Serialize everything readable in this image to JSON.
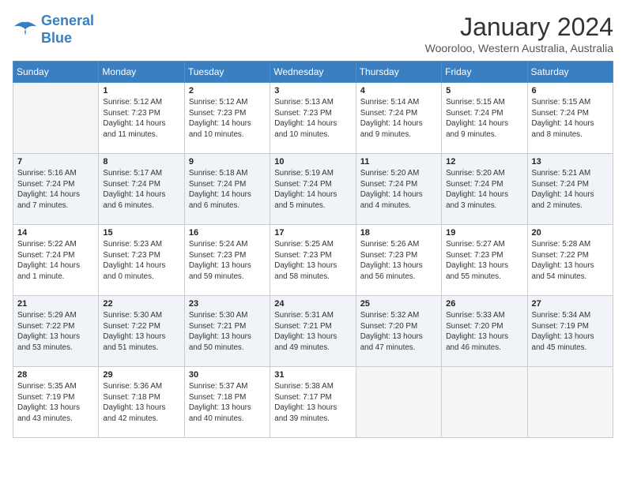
{
  "header": {
    "logo_line1": "General",
    "logo_line2": "Blue",
    "month": "January 2024",
    "location": "Wooroloo, Western Australia, Australia"
  },
  "weekdays": [
    "Sunday",
    "Monday",
    "Tuesday",
    "Wednesday",
    "Thursday",
    "Friday",
    "Saturday"
  ],
  "weeks": [
    [
      {
        "day": "",
        "info": ""
      },
      {
        "day": "1",
        "info": "Sunrise: 5:12 AM\nSunset: 7:23 PM\nDaylight: 14 hours\nand 11 minutes."
      },
      {
        "day": "2",
        "info": "Sunrise: 5:12 AM\nSunset: 7:23 PM\nDaylight: 14 hours\nand 10 minutes."
      },
      {
        "day": "3",
        "info": "Sunrise: 5:13 AM\nSunset: 7:23 PM\nDaylight: 14 hours\nand 10 minutes."
      },
      {
        "day": "4",
        "info": "Sunrise: 5:14 AM\nSunset: 7:24 PM\nDaylight: 14 hours\nand 9 minutes."
      },
      {
        "day": "5",
        "info": "Sunrise: 5:15 AM\nSunset: 7:24 PM\nDaylight: 14 hours\nand 9 minutes."
      },
      {
        "day": "6",
        "info": "Sunrise: 5:15 AM\nSunset: 7:24 PM\nDaylight: 14 hours\nand 8 minutes."
      }
    ],
    [
      {
        "day": "7",
        "info": "Sunrise: 5:16 AM\nSunset: 7:24 PM\nDaylight: 14 hours\nand 7 minutes."
      },
      {
        "day": "8",
        "info": "Sunrise: 5:17 AM\nSunset: 7:24 PM\nDaylight: 14 hours\nand 6 minutes."
      },
      {
        "day": "9",
        "info": "Sunrise: 5:18 AM\nSunset: 7:24 PM\nDaylight: 14 hours\nand 6 minutes."
      },
      {
        "day": "10",
        "info": "Sunrise: 5:19 AM\nSunset: 7:24 PM\nDaylight: 14 hours\nand 5 minutes."
      },
      {
        "day": "11",
        "info": "Sunrise: 5:20 AM\nSunset: 7:24 PM\nDaylight: 14 hours\nand 4 minutes."
      },
      {
        "day": "12",
        "info": "Sunrise: 5:20 AM\nSunset: 7:24 PM\nDaylight: 14 hours\nand 3 minutes."
      },
      {
        "day": "13",
        "info": "Sunrise: 5:21 AM\nSunset: 7:24 PM\nDaylight: 14 hours\nand 2 minutes."
      }
    ],
    [
      {
        "day": "14",
        "info": "Sunrise: 5:22 AM\nSunset: 7:24 PM\nDaylight: 14 hours\nand 1 minute."
      },
      {
        "day": "15",
        "info": "Sunrise: 5:23 AM\nSunset: 7:23 PM\nDaylight: 14 hours\nand 0 minutes."
      },
      {
        "day": "16",
        "info": "Sunrise: 5:24 AM\nSunset: 7:23 PM\nDaylight: 13 hours\nand 59 minutes."
      },
      {
        "day": "17",
        "info": "Sunrise: 5:25 AM\nSunset: 7:23 PM\nDaylight: 13 hours\nand 58 minutes."
      },
      {
        "day": "18",
        "info": "Sunrise: 5:26 AM\nSunset: 7:23 PM\nDaylight: 13 hours\nand 56 minutes."
      },
      {
        "day": "19",
        "info": "Sunrise: 5:27 AM\nSunset: 7:23 PM\nDaylight: 13 hours\nand 55 minutes."
      },
      {
        "day": "20",
        "info": "Sunrise: 5:28 AM\nSunset: 7:22 PM\nDaylight: 13 hours\nand 54 minutes."
      }
    ],
    [
      {
        "day": "21",
        "info": "Sunrise: 5:29 AM\nSunset: 7:22 PM\nDaylight: 13 hours\nand 53 minutes."
      },
      {
        "day": "22",
        "info": "Sunrise: 5:30 AM\nSunset: 7:22 PM\nDaylight: 13 hours\nand 51 minutes."
      },
      {
        "day": "23",
        "info": "Sunrise: 5:30 AM\nSunset: 7:21 PM\nDaylight: 13 hours\nand 50 minutes."
      },
      {
        "day": "24",
        "info": "Sunrise: 5:31 AM\nSunset: 7:21 PM\nDaylight: 13 hours\nand 49 minutes."
      },
      {
        "day": "25",
        "info": "Sunrise: 5:32 AM\nSunset: 7:20 PM\nDaylight: 13 hours\nand 47 minutes."
      },
      {
        "day": "26",
        "info": "Sunrise: 5:33 AM\nSunset: 7:20 PM\nDaylight: 13 hours\nand 46 minutes."
      },
      {
        "day": "27",
        "info": "Sunrise: 5:34 AM\nSunset: 7:19 PM\nDaylight: 13 hours\nand 45 minutes."
      }
    ],
    [
      {
        "day": "28",
        "info": "Sunrise: 5:35 AM\nSunset: 7:19 PM\nDaylight: 13 hours\nand 43 minutes."
      },
      {
        "day": "29",
        "info": "Sunrise: 5:36 AM\nSunset: 7:18 PM\nDaylight: 13 hours\nand 42 minutes."
      },
      {
        "day": "30",
        "info": "Sunrise: 5:37 AM\nSunset: 7:18 PM\nDaylight: 13 hours\nand 40 minutes."
      },
      {
        "day": "31",
        "info": "Sunrise: 5:38 AM\nSunset: 7:17 PM\nDaylight: 13 hours\nand 39 minutes."
      },
      {
        "day": "",
        "info": ""
      },
      {
        "day": "",
        "info": ""
      },
      {
        "day": "",
        "info": ""
      }
    ]
  ]
}
